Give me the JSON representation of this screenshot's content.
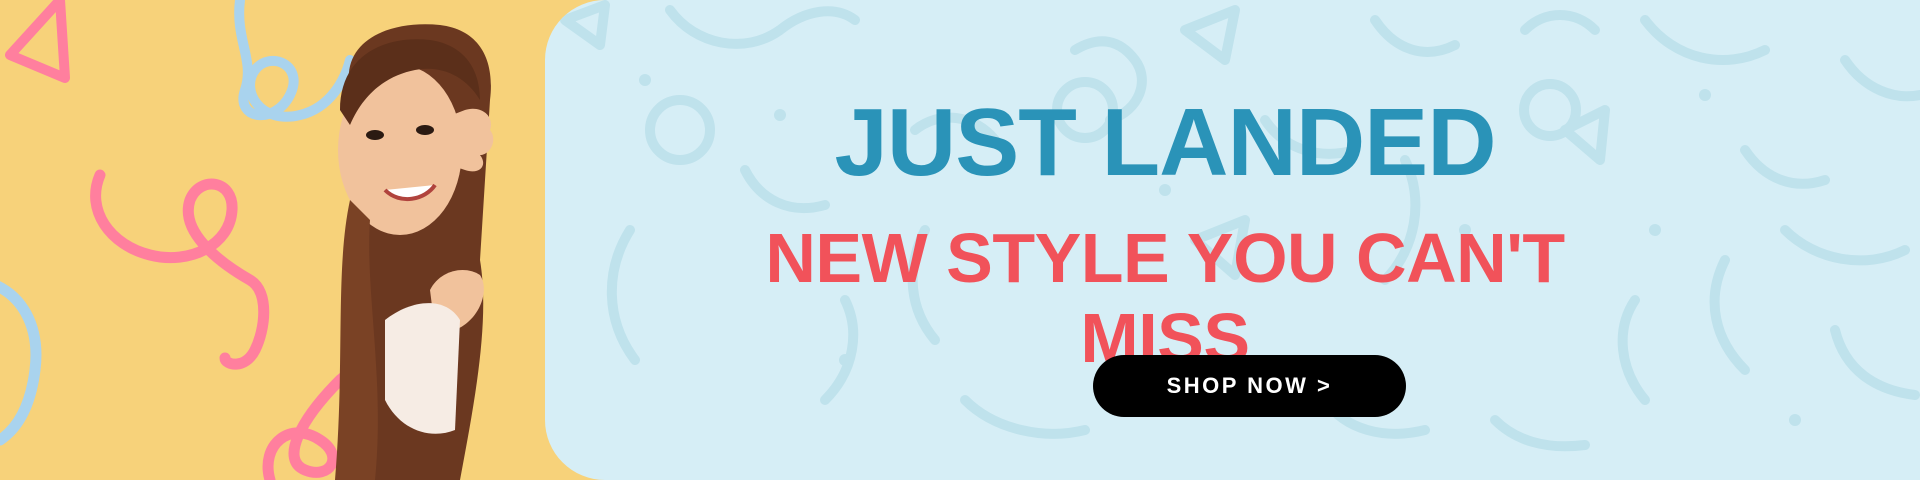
{
  "banner": {
    "headline": "JUST LANDED",
    "subheadline": "NEW STYLE YOU CAN'T MISS",
    "cta_label": "SHOP NOW >"
  },
  "colors": {
    "left_bg": "#f7d27a",
    "right_bg": "#d6eef6",
    "headline": "#2a93b8",
    "subheadline": "#f1525a",
    "button_bg": "#000000",
    "button_text": "#ffffff",
    "squiggle_pink": "#ff7f9e",
    "squiggle_blue": "#a9d3ee",
    "pattern_blue": "#bfe2ec"
  },
  "icons": [
    "triangle-squiggle-icon",
    "loop-squiggle-icon",
    "child-photo"
  ]
}
